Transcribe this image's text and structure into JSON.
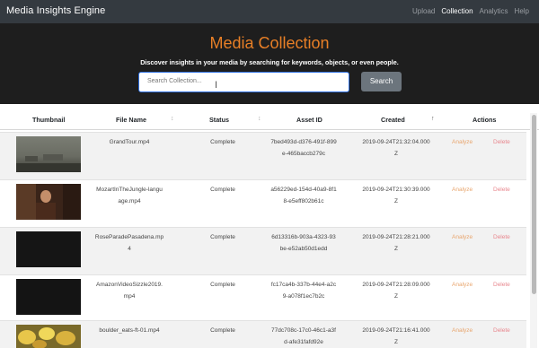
{
  "navbar": {
    "brand": "Media Insights Engine",
    "links": [
      "Upload",
      "Collection",
      "Analytics",
      "Help"
    ]
  },
  "hero": {
    "title": "Media Collection",
    "subtitle": "Discover insights in your media by searching for keywords, objects, or even people."
  },
  "search": {
    "placeholder": "Search Collection...",
    "button_label": "Search"
  },
  "table": {
    "headers": [
      "Thumbnail",
      "File Name",
      "Status",
      "Asset ID",
      "Created",
      "Actions"
    ],
    "sort_icons": [
      "↕",
      "↕",
      "↑"
    ],
    "rows": [
      {
        "file_name": [
          "GrandTour.mp4"
        ],
        "status": "Complete",
        "asset_id": [
          "7bed493d-d376-491f-899",
          "e-465baccb279c"
        ],
        "created": [
          "2019-09-24T21:32:04.000",
          "Z"
        ],
        "analyze": "Analyze",
        "delete": "Delete"
      },
      {
        "file_name": [
          "MozartInTheJungle-langu",
          "age.mp4"
        ],
        "status": "Complete",
        "asset_id": [
          "a56229ed-154d-40a9-8f1",
          "8-e5eff802b61c"
        ],
        "created": [
          "2019-09-24T21:30:39.000",
          "Z"
        ],
        "analyze": "Analyze",
        "delete": "Delete"
      },
      {
        "file_name": [
          "RoseParadePasadena.mp",
          "4"
        ],
        "status": "Complete",
        "asset_id": [
          "6d13316b-903a-4323-93",
          "be-e52ab50d1edd"
        ],
        "created": [
          "2019-09-24T21:28:21.000",
          "Z"
        ],
        "analyze": "Analyze",
        "delete": "Delete"
      },
      {
        "file_name": [
          "AmazonVideoSizzle2019.",
          "mp4"
        ],
        "status": "Complete",
        "asset_id": [
          "fc17ca4b-337b-44e4-a2c",
          "9-a078f1ec7b2c"
        ],
        "created": [
          "2019-09-24T21:28:09.000",
          "Z"
        ],
        "analyze": "Analyze",
        "delete": "Delete"
      },
      {
        "file_name": [
          "boulder_eats-ft-01.mp4"
        ],
        "status": "Complete",
        "asset_id": [
          "77dc708c-17c0-46c1-a3f",
          "d-afe31fafd92e"
        ],
        "created": [
          "2019-09-24T21:16:41.000",
          "Z"
        ],
        "analyze": "Analyze",
        "delete": "Delete"
      }
    ]
  },
  "colors": {
    "navbar": "#343a40",
    "hero_background": "#1e1e1e",
    "accent_orange": "#e87f26",
    "analyze_link": "#e8a56d",
    "delete_link": "#e8878e",
    "search_button": "#6c757d",
    "input_focus": "#2e6fe0"
  }
}
